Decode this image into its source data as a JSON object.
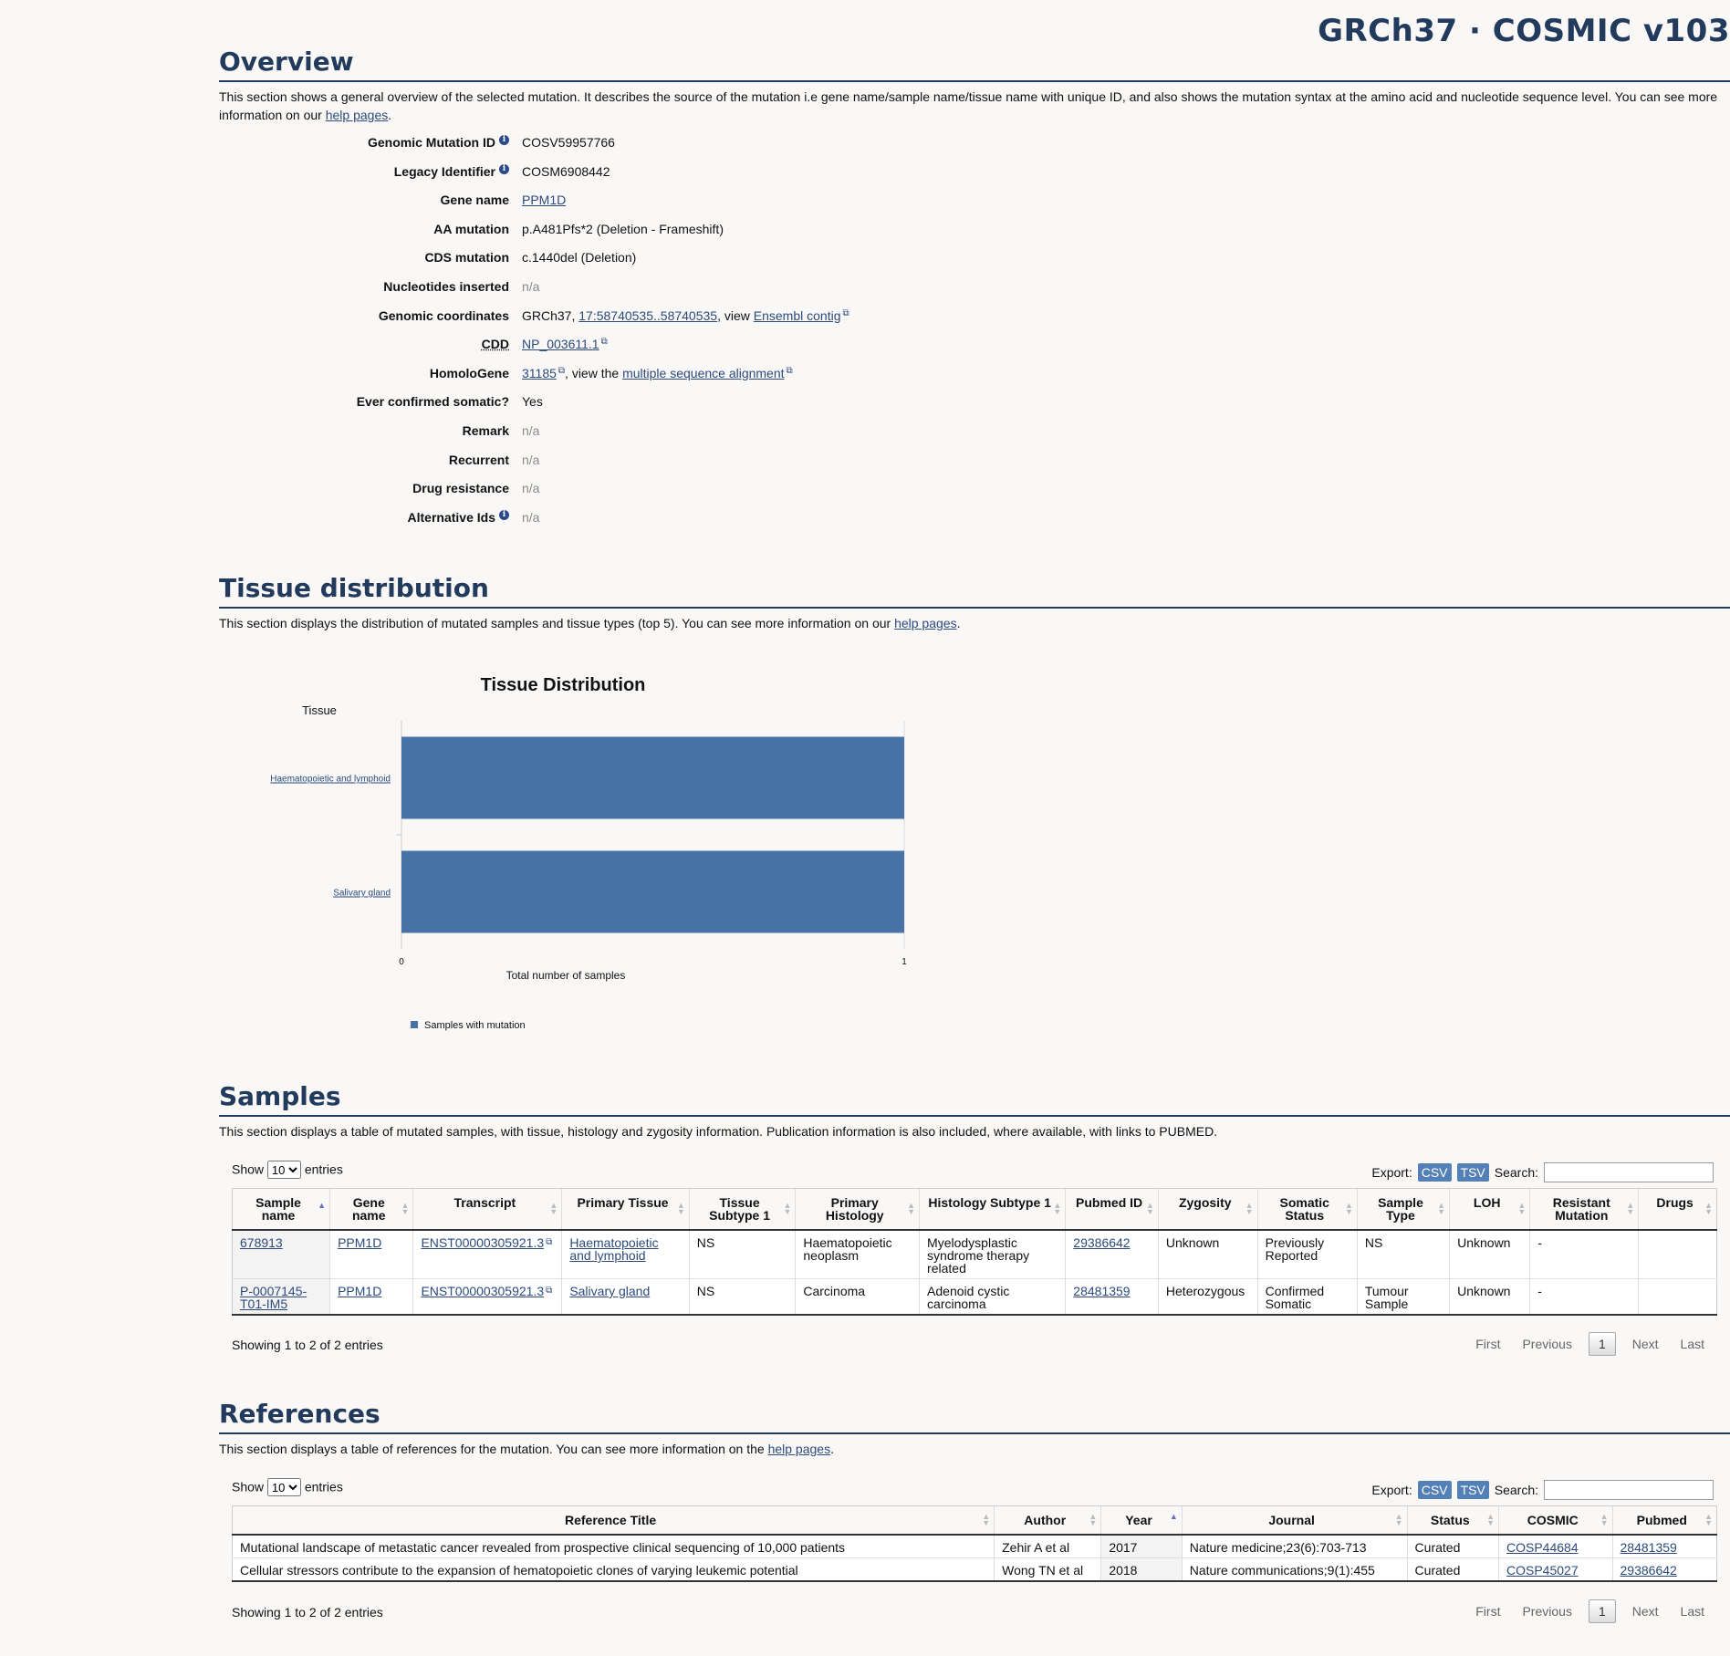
{
  "brand": "GRCh37 · COSMIC v103",
  "overview": {
    "title": "Overview",
    "desc_prefix": "This section shows a general overview of the selected mutation. It describes the source of the mutation i.e gene name/sample name/tissue name with unique ID, and also shows the mutation syntax at the amino acid and nucleotide sequence level. You can see more information on our ",
    "desc_link": "help pages",
    "desc_suffix": ".",
    "fields": {
      "gmid_label": "Genomic Mutation ID",
      "gmid_value": "COSV59957766",
      "legacy_label": "Legacy Identifier",
      "legacy_value": "COSM6908442",
      "gene_label": "Gene name",
      "gene_value": "PPM1D",
      "aa_label": "AA mutation",
      "aa_value": "p.A481Pfs*2 (Deletion - Frameshift)",
      "cds_label": "CDS mutation",
      "cds_value": "c.1440del (Deletion)",
      "nuc_label": "Nucleotides inserted",
      "nuc_value": "n/a",
      "coords_label": "Genomic coordinates",
      "coords_prefix": "GRCh37, ",
      "coords_link": "17:58740535..58740535",
      "coords_mid": ", view ",
      "coords_link2": "Ensembl contig",
      "cdd_label": "CDD",
      "cdd_value": "NP_003611.1",
      "homolo_label": "HomoloGene",
      "homolo_value": "31185",
      "homolo_mid": ", view the ",
      "homolo_link2": "multiple sequence alignment",
      "somatic_label": "Ever confirmed somatic?",
      "somatic_value": "Yes",
      "remark_label": "Remark",
      "remark_value": "n/a",
      "recurrent_label": "Recurrent",
      "recurrent_value": "n/a",
      "drug_label": "Drug resistance",
      "drug_value": "n/a",
      "alt_label": "Alternative Ids",
      "alt_value": "n/a"
    }
  },
  "tissue": {
    "title": "Tissue distribution",
    "desc_prefix": "This section displays the distribution of mutated samples and tissue types (top 5). You can see more information on our ",
    "desc_link": "help pages",
    "desc_suffix": "."
  },
  "chart_data": {
    "type": "bar",
    "orientation": "horizontal",
    "title": "Tissue Distribution",
    "ylabel": "Tissue",
    "xlabel": "Total number of samples",
    "categories": [
      "Haematopoietic and lymphoid",
      "Salivary gland"
    ],
    "series": [
      {
        "name": "Samples with mutation",
        "values": [
          1,
          1
        ]
      }
    ],
    "xlim": [
      0,
      1
    ],
    "xticks": [
      "0",
      "1"
    ],
    "color": "#4672a6",
    "legend": "bottom-left"
  },
  "samples": {
    "title": "Samples",
    "desc": "This section displays a table of mutated samples, with tissue, histology and zygosity information. Publication information is also included, where available, with links to PUBMED.",
    "show": "Show",
    "entries_value": "10",
    "entries": "entries",
    "export": "Export:",
    "csv": "CSV",
    "tsv": "TSV",
    "search": "Search:",
    "headers": [
      "Sample name",
      "Gene name",
      "Transcript",
      "Primary Tissue",
      "Tissue Subtype 1",
      "Primary Histology",
      "Histology Subtype 1",
      "Pubmed ID",
      "Zygosity",
      "Somatic Status",
      "Sample Type",
      "LOH",
      "Resistant Mutation",
      "Drugs"
    ],
    "rows": [
      [
        "678913",
        "PPM1D",
        "ENST00000305921.3",
        "Haematopoietic and lymphoid",
        "NS",
        "Haematopoietic neoplasm",
        "Myelodysplastic syndrome therapy related",
        "29386642",
        "Unknown",
        "Previously Reported",
        "NS",
        "Unknown",
        "-",
        ""
      ],
      [
        "P-0007145-T01-IM5",
        "PPM1D",
        "ENST00000305921.3",
        "Salivary gland",
        "NS",
        "Carcinoma",
        "Adenoid cystic carcinoma",
        "28481359",
        "Heterozygous",
        "Confirmed Somatic",
        "Tumour Sample",
        "Unknown",
        "-",
        ""
      ]
    ],
    "showing": "Showing 1 to 2 of 2 entries",
    "pager": {
      "first": "First",
      "previous": "Previous",
      "current": "1",
      "next": "Next",
      "last": "Last"
    }
  },
  "references": {
    "title": "References",
    "desc_prefix": "This section displays a table of references for the mutation. You can see more information on the ",
    "desc_link": "help pages",
    "desc_suffix": ".",
    "show": "Show",
    "entries_value": "10",
    "entries": "entries",
    "export": "Export:",
    "csv": "CSV",
    "tsv": "TSV",
    "search": "Search:",
    "headers": [
      "Reference Title",
      "Author",
      "Year",
      "Journal",
      "Status",
      "COSMIC",
      "Pubmed"
    ],
    "rows": [
      [
        "Mutational landscape of metastatic cancer revealed from prospective clinical sequencing of 10,000 patients",
        "Zehir A et al",
        "2017",
        "Nature medicine;23(6):703-713",
        "Curated",
        "COSP44684",
        "28481359"
      ],
      [
        "Cellular stressors contribute to the expansion of hematopoietic clones of varying leukemic potential",
        "Wong TN et al",
        "2018",
        "Nature communications;9(1):455",
        "Curated",
        "COSP45027",
        "29386642"
      ]
    ],
    "showing": "Showing 1 to 2 of 2 entries",
    "pager": {
      "first": "First",
      "previous": "Previous",
      "current": "1",
      "next": "Next",
      "last": "Last"
    }
  }
}
